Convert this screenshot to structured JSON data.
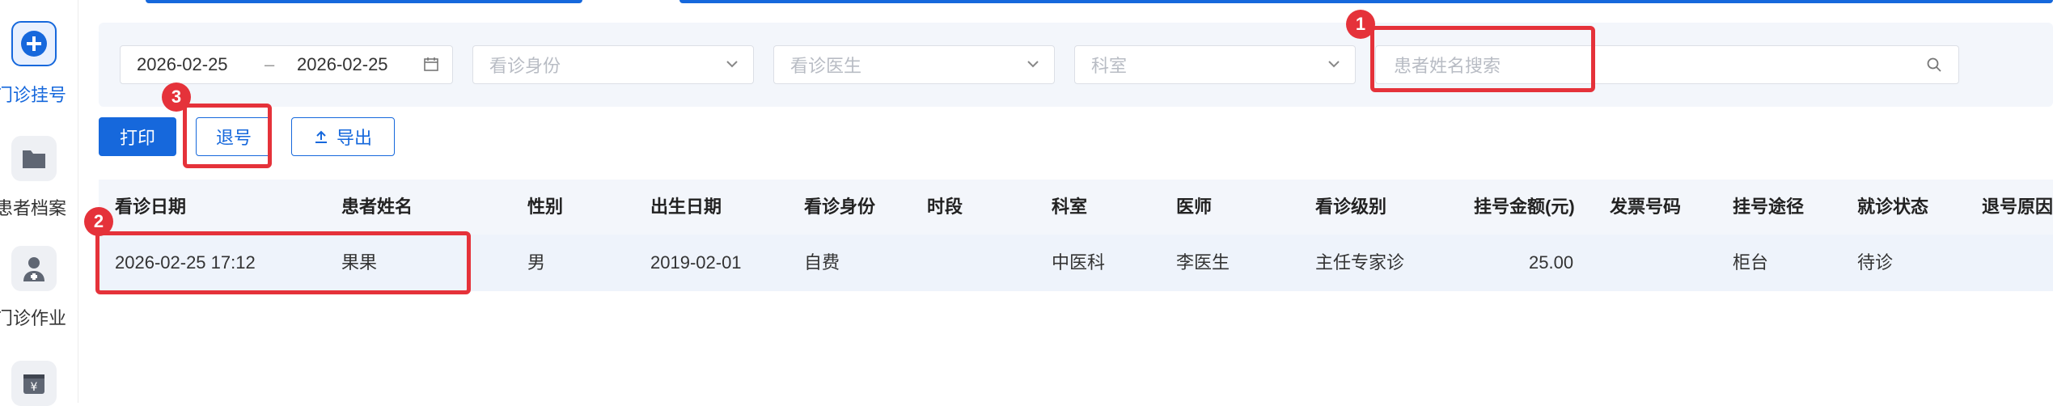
{
  "sidebar": {
    "items": [
      {
        "label": "门诊挂号",
        "icon": "plus-circle-icon",
        "active": true
      },
      {
        "label": "患者档案",
        "icon": "folder-icon",
        "active": false
      },
      {
        "label": "门诊作业",
        "icon": "doctor-icon",
        "active": false
      },
      {
        "label": "",
        "icon": "yen-icon",
        "active": false
      }
    ]
  },
  "filters": {
    "date_start": "2026-02-25",
    "date_sep": "–",
    "date_end": "2026-02-25",
    "visit_identity_placeholder": "看诊身份",
    "doctor_placeholder": "看诊医生",
    "department_placeholder": "科室",
    "search_placeholder": "患者姓名搜索"
  },
  "toolbar": {
    "print_label": "打印",
    "refund_label": "退号",
    "export_label": "导出"
  },
  "table": {
    "headers": [
      "看诊日期",
      "患者姓名",
      "性别",
      "出生日期",
      "看诊身份",
      "时段",
      "科室",
      "医师",
      "看诊级别",
      "挂号金额(元)",
      "发票号码",
      "挂号途径",
      "就诊状态",
      "退号原因"
    ],
    "rows": [
      [
        "2026-02-25 17:12",
        "果果",
        "男",
        "2019-02-01",
        "自费",
        "",
        "中医科",
        "李医生",
        "主任专家诊",
        "25.00",
        "",
        "柜台",
        "待诊",
        ""
      ]
    ]
  },
  "annotations": [
    "1",
    "2",
    "3"
  ],
  "colors": {
    "accent": "#1668dc",
    "highlight": "#e5323a",
    "panel": "#f3f6fb"
  }
}
